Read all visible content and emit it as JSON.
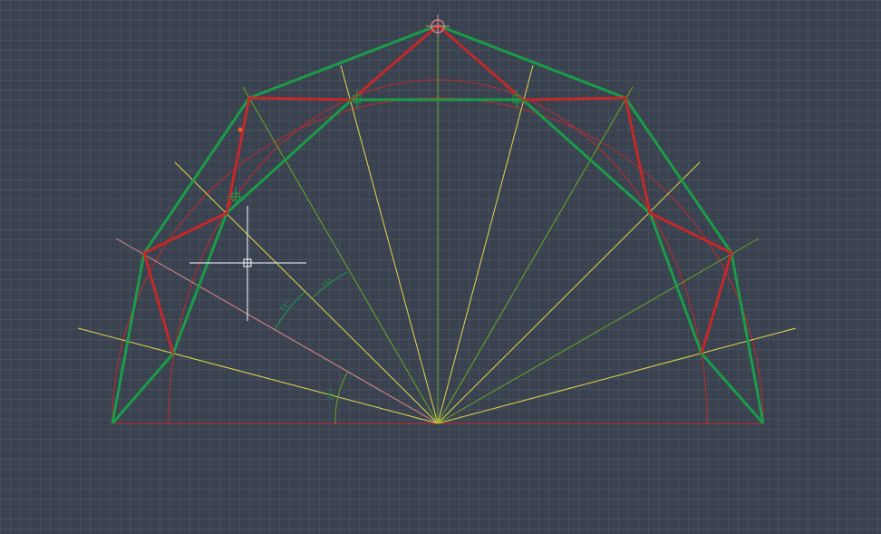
{
  "drawing": {
    "colors": {
      "background": "#3a4250",
      "construction_red": "#c02a2a",
      "polygon_red": "#c42828",
      "polygon_green": "#1a9c48",
      "ray_yellow": "#e4d84a",
      "ray_green": "#6aa820",
      "crosshair": "#ffffff",
      "ray_pink": "#e88a8a"
    },
    "dimensions": {
      "angle_1": "15°",
      "angle_2": "15°",
      "angle_3": "15°"
    },
    "cursor": {
      "type": "crosshair-pickbox"
    }
  }
}
